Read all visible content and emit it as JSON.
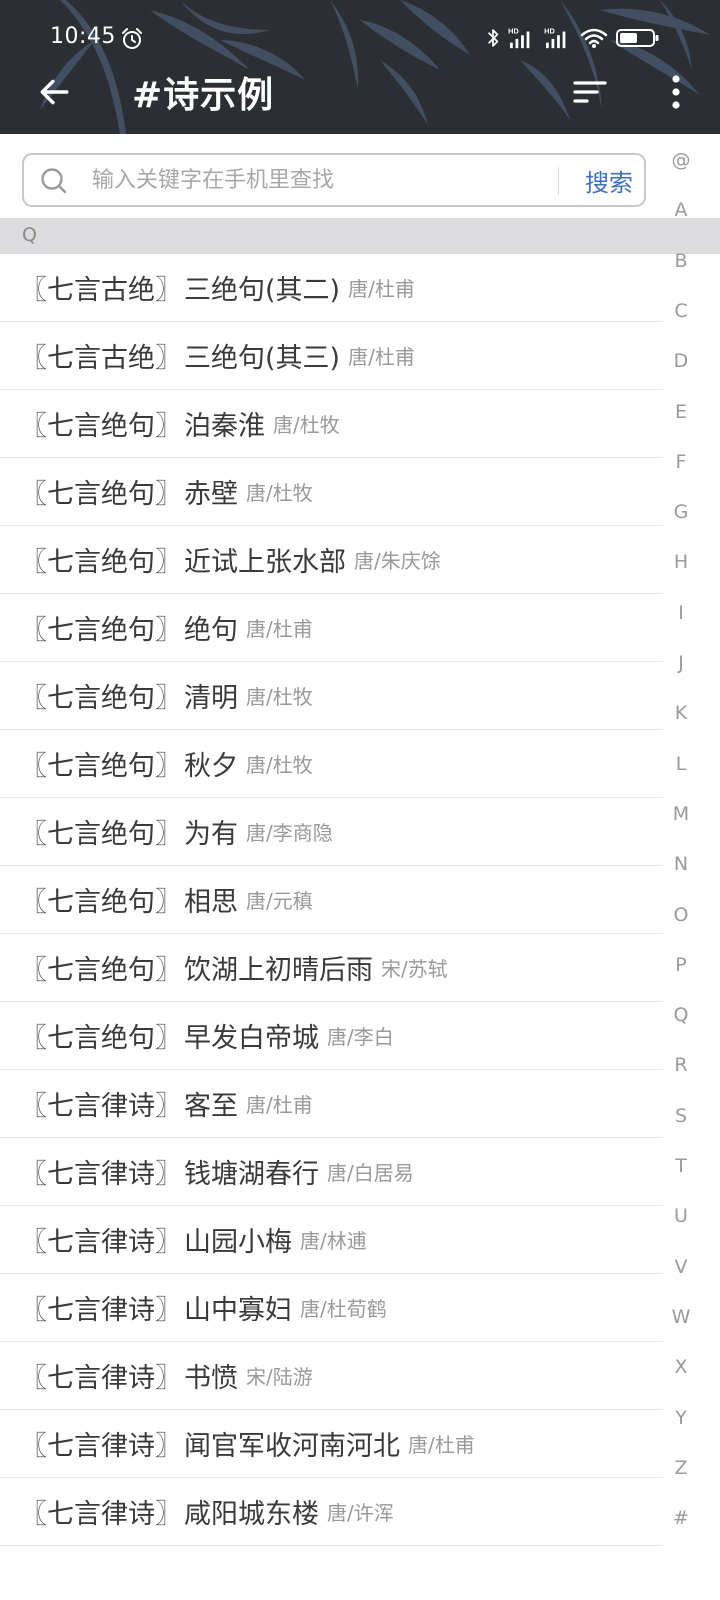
{
  "status_bar": {
    "time": "10:45",
    "alarm": "alarm-clock-icon",
    "icons": [
      "bluetooth-icon",
      "signal-hd-icon",
      "signal-hd-icon",
      "wifi-icon",
      "battery-icon"
    ],
    "hd_label": "HD"
  },
  "header": {
    "title": "#诗示例",
    "back_icon": "arrow-left-icon",
    "sort_icon": "sort-lines-icon",
    "more_icon": "more-vertical-icon"
  },
  "search": {
    "placeholder": "输入关键字在手机里查找",
    "value": "",
    "button_label": "搜索"
  },
  "section": {
    "letter": "Q"
  },
  "poems": [
    {
      "category": "〖七言古绝〗",
      "title": "三绝句(其二)",
      "author": "唐/杜甫"
    },
    {
      "category": "〖七言古绝〗",
      "title": "三绝句(其三)",
      "author": "唐/杜甫"
    },
    {
      "category": "〖七言绝句〗",
      "title": "泊秦淮",
      "author": "唐/杜牧"
    },
    {
      "category": "〖七言绝句〗",
      "title": "赤壁",
      "author": "唐/杜牧"
    },
    {
      "category": "〖七言绝句〗",
      "title": "近试上张水部",
      "author": "唐/朱庆馀"
    },
    {
      "category": "〖七言绝句〗",
      "title": "绝句",
      "author": "唐/杜甫"
    },
    {
      "category": "〖七言绝句〗",
      "title": "清明",
      "author": "唐/杜牧"
    },
    {
      "category": "〖七言绝句〗",
      "title": "秋夕",
      "author": "唐/杜牧"
    },
    {
      "category": "〖七言绝句〗",
      "title": "为有",
      "author": "唐/李商隐"
    },
    {
      "category": "〖七言绝句〗",
      "title": "相思",
      "author": "唐/元稹"
    },
    {
      "category": "〖七言绝句〗",
      "title": "饮湖上初晴后雨",
      "author": "宋/苏轼"
    },
    {
      "category": "〖七言绝句〗",
      "title": "早发白帝城",
      "author": "唐/李白"
    },
    {
      "category": "〖七言律诗〗",
      "title": "客至",
      "author": "唐/杜甫"
    },
    {
      "category": "〖七言律诗〗",
      "title": "钱塘湖春行",
      "author": "唐/白居易"
    },
    {
      "category": "〖七言律诗〗",
      "title": "山园小梅",
      "author": "唐/林逋"
    },
    {
      "category": "〖七言律诗〗",
      "title": "山中寡妇",
      "author": "唐/杜荀鹤"
    },
    {
      "category": "〖七言律诗〗",
      "title": "书愤",
      "author": "宋/陆游"
    },
    {
      "category": "〖七言律诗〗",
      "title": "闻官军收河南河北",
      "author": "唐/杜甫"
    },
    {
      "category": "〖七言律诗〗",
      "title": "咸阳城东楼",
      "author": "唐/许浑"
    }
  ],
  "index_letters": [
    "@",
    "A",
    "B",
    "C",
    "D",
    "E",
    "F",
    "G",
    "H",
    "I",
    "J",
    "K",
    "L",
    "M",
    "N",
    "O",
    "P",
    "Q",
    "R",
    "S",
    "T",
    "U",
    "V",
    "W",
    "X",
    "Y",
    "Z",
    "#"
  ],
  "colors": {
    "header_bg": "#2b2e33",
    "accent": "#3f6fbd",
    "section_bg": "#dcdcde",
    "primary_text": "#3a3a3a",
    "secondary_text": "#9a9a9a"
  }
}
